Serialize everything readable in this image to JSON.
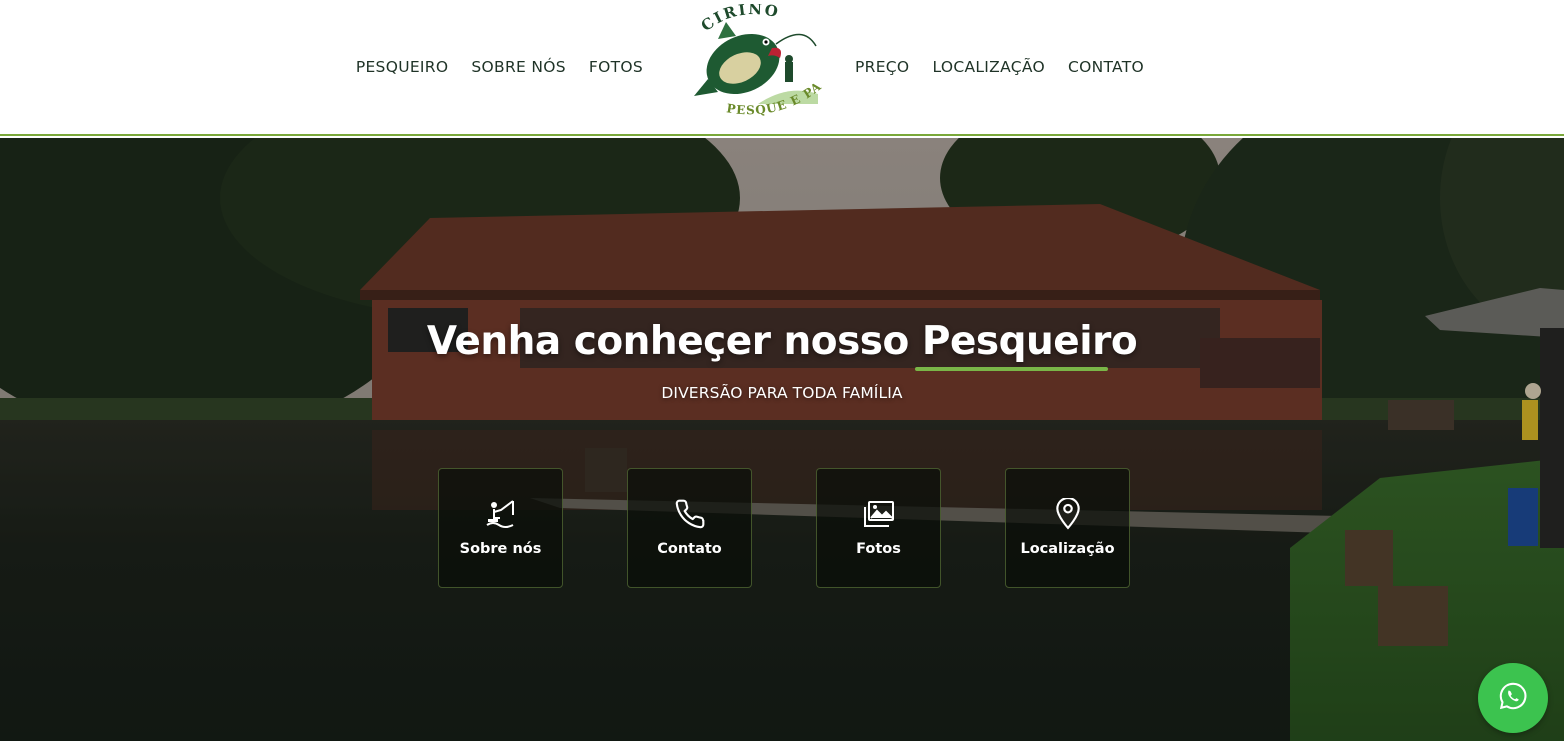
{
  "header": {
    "nav_left": [
      {
        "label": "PESQUEIRO"
      },
      {
        "label": "SOBRE NÓS"
      },
      {
        "label": "FOTOS"
      }
    ],
    "nav_right": [
      {
        "label": "PREÇO"
      },
      {
        "label": "LOCALIZAÇÃO"
      },
      {
        "label": "CONTATO"
      }
    ],
    "logo": {
      "top_text": "CIRINO",
      "bottom_text": "PESQUE E PAGUE"
    }
  },
  "hero": {
    "title": "Venha conheçer nosso Pesqueiro",
    "subtitle": "DIVERSÃO PARA TODA FAMÍLIA",
    "cards": [
      {
        "label": "Sobre nós",
        "icon": "fishing-icon"
      },
      {
        "label": "Contato",
        "icon": "phone-icon"
      },
      {
        "label": "Fotos",
        "icon": "images-icon"
      },
      {
        "label": "Localização",
        "icon": "map-pin-icon"
      }
    ]
  },
  "floating": {
    "icon": "whatsapp-icon"
  },
  "colors": {
    "accent_green": "#7ab648",
    "nav_text": "#1f3327",
    "whatsapp": "#3cc34f",
    "logo_green": "#1e5a32"
  }
}
